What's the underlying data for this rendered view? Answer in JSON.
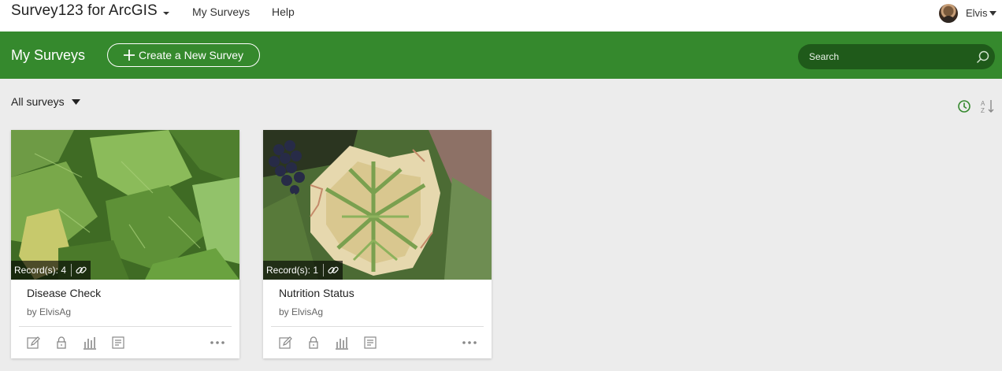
{
  "header": {
    "app_title": "Survey123 for ArcGIS",
    "nav": [
      "My Surveys",
      "Help"
    ],
    "user_name": "Elvis"
  },
  "banner": {
    "title": "My Surveys",
    "create_label": "Create a New Survey",
    "search_placeholder": "Search"
  },
  "filter": {
    "label": "All surveys"
  },
  "surveys": [
    {
      "title": "Disease Check",
      "owner": "by ElvisAg",
      "records": "Record(s): 4",
      "thumb_icon": "green-grape-leaves-image"
    },
    {
      "title": "Nutrition Status",
      "owner": "by ElvisAg",
      "records": "Record(s): 1",
      "thumb_icon": "chlorotic-grape-leaf-image"
    }
  ],
  "colors": {
    "accent": "#35892d",
    "search_bg": "#1f5a1a",
    "page_bg": "#ececec"
  },
  "icons": [
    "chevron-down-icon",
    "avatar",
    "plus-icon",
    "search-icon",
    "recent-icon",
    "sort-az-icon",
    "link-icon",
    "edit-icon",
    "lock-icon",
    "chart-icon",
    "form-icon",
    "more-icon"
  ]
}
